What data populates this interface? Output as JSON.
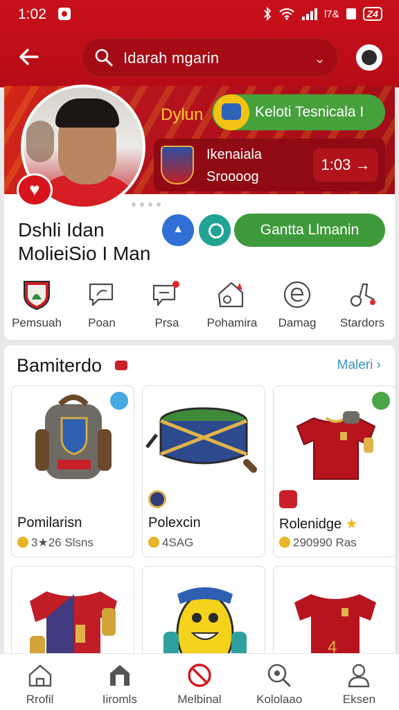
{
  "status": {
    "time": "1:02",
    "battery": "Z4"
  },
  "search": {
    "query": "Idarah mgarin"
  },
  "hero": {
    "label": "Dylun",
    "team_label": "Keloti Tesnicala I",
    "club_name": "Ikenaiala",
    "club_sub": "Sroooog",
    "timer": "1:03 →"
  },
  "profile": {
    "name_line1": "Dshli Idan",
    "name_line2": "MolieiSio I Man",
    "cta": "Gantta Llmanin"
  },
  "quick_actions": [
    {
      "label": "Pemsuah",
      "icon": "crest-icon"
    },
    {
      "label": "Poan",
      "icon": "chat-icon"
    },
    {
      "label": "Prsa",
      "icon": "message-icon"
    },
    {
      "label": "Pohamira",
      "icon": "home-icon"
    },
    {
      "label": "Damag",
      "icon": "e-icon"
    },
    {
      "label": "Stardors",
      "icon": "whistle-icon"
    }
  ],
  "featured": {
    "title": "Bamiterdo",
    "more": "Maleri",
    "items": [
      {
        "name": "Pomilarisn",
        "price": "3★26 Slsns",
        "icon": "backpack-icon"
      },
      {
        "name": "Polexcin",
        "price": "4SAG",
        "icon": "drum-icon"
      },
      {
        "name": "Rolenidge",
        "price": "290990 Ras",
        "icon": "jersey-icon"
      },
      {
        "name": "",
        "price": "",
        "icon": "jersey-icon"
      },
      {
        "name": "",
        "price": "",
        "icon": "mascot-icon"
      },
      {
        "name": "",
        "price": "",
        "icon": "jersey-icon"
      }
    ]
  },
  "nav": [
    {
      "label": "Rrofil",
      "icon": "home-icon"
    },
    {
      "label": "Iiromls",
      "icon": "building-icon"
    },
    {
      "label": "Melbinal",
      "icon": "ban-icon"
    },
    {
      "label": "Kololaao",
      "icon": "search-icon"
    },
    {
      "label": "Eksen",
      "icon": "user-icon"
    }
  ],
  "colors": {
    "primary": "#c8101b",
    "green": "#3f9a3c",
    "blue": "#2f6fd6",
    "teal": "#22a394",
    "gold": "#ffc637"
  }
}
